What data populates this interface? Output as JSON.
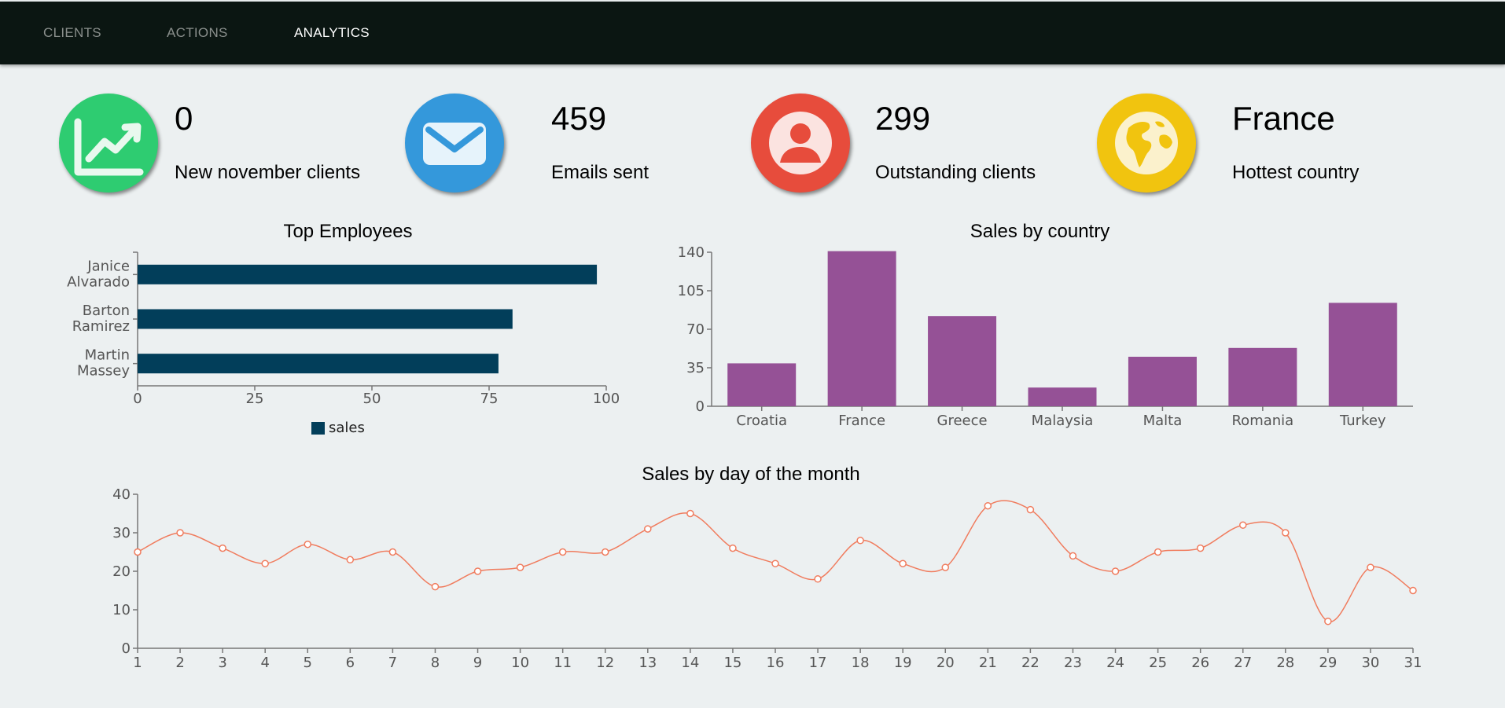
{
  "nav": {
    "items": [
      {
        "label": "CLIENTS",
        "active": false
      },
      {
        "label": "ACTIONS",
        "active": false
      },
      {
        "label": "ANALYTICS",
        "active": true
      }
    ]
  },
  "stats": [
    {
      "value": "0",
      "label": "New november clients",
      "icon": "trending-up-icon",
      "color": "#2ecc71"
    },
    {
      "value": "459",
      "label": "Emails sent",
      "icon": "envelope-icon",
      "color": "#3498db"
    },
    {
      "value": "299",
      "label": "Outstanding clients",
      "icon": "user-icon",
      "color": "#e74c3c"
    },
    {
      "value": "France",
      "label": "Hottest country",
      "icon": "globe-icon",
      "color": "#f1c40f"
    }
  ],
  "chart_data": [
    {
      "type": "bar",
      "orientation": "horizontal",
      "title": "Top Employees",
      "categories": [
        "Janice Alvarado",
        "Barton Ramirez",
        "Martin Massey"
      ],
      "series": [
        {
          "name": "sales",
          "values": [
            98,
            80,
            77
          ],
          "color": "#023e5a"
        }
      ],
      "xlim": [
        0,
        100
      ],
      "xticks": [
        0,
        25,
        50,
        75,
        100
      ],
      "legend": "bottom",
      "grid": false
    },
    {
      "type": "bar",
      "title": "Sales by country",
      "categories": [
        "Croatia",
        "France",
        "Greece",
        "Malaysia",
        "Malta",
        "Romania",
        "Turkey"
      ],
      "values": [
        39,
        141,
        82,
        17,
        45,
        53,
        94
      ],
      "color": "#955196",
      "ylim": [
        0,
        140
      ],
      "yticks": [
        0,
        35,
        70,
        105,
        140
      ],
      "grid": false
    },
    {
      "type": "line",
      "title": "Sales by day of the month",
      "x": [
        1,
        2,
        3,
        4,
        5,
        6,
        7,
        8,
        9,
        10,
        11,
        12,
        13,
        14,
        15,
        16,
        17,
        18,
        19,
        20,
        21,
        22,
        23,
        24,
        25,
        26,
        27,
        28,
        29,
        30,
        31
      ],
      "values": [
        25,
        30,
        26,
        22,
        27,
        23,
        25,
        16,
        20,
        21,
        25,
        25,
        31,
        35,
        26,
        22,
        18,
        28,
        22,
        21,
        37,
        36,
        24,
        20,
        25,
        26,
        32,
        30,
        7,
        21,
        15
      ],
      "color": "#f07c5e",
      "ylim": [
        0,
        40
      ],
      "yticks": [
        0,
        10,
        20,
        30,
        40
      ],
      "grid": false
    }
  ]
}
